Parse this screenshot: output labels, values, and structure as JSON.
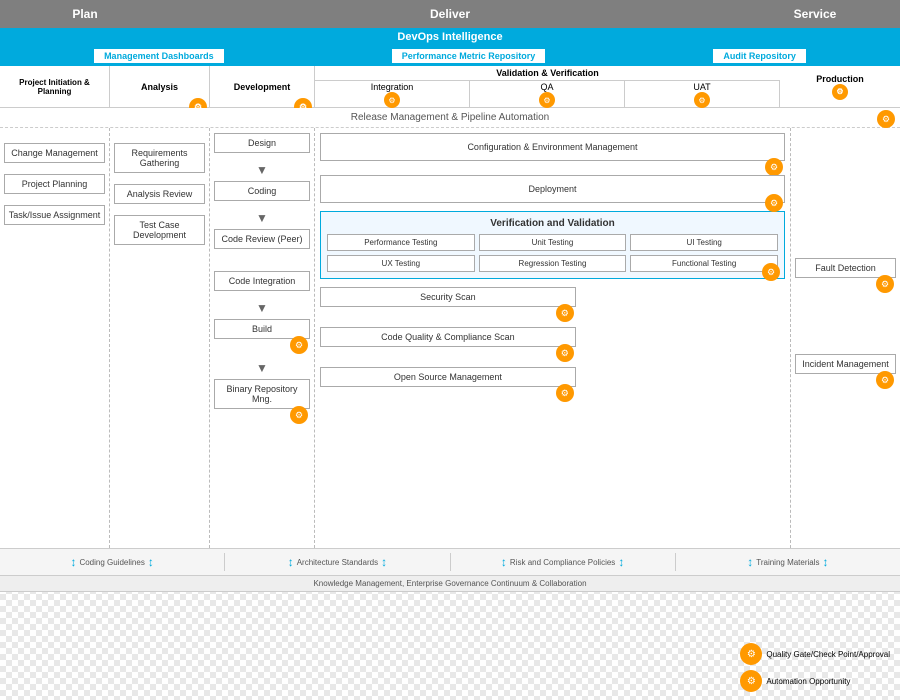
{
  "header": {
    "phases": {
      "plan": "Plan",
      "deliver": "Deliver",
      "service": "Service"
    }
  },
  "devops": {
    "title": "DevOps Intelligence",
    "sub_items": [
      "Management Dashboards",
      "Performance Metric Repository",
      "Audit Repository"
    ]
  },
  "lifecycle": {
    "project": "Project Initiation & Planning",
    "analysis": "Analysis",
    "development": "Development",
    "vv": "Validation & Verification",
    "integration": "Integration",
    "qa": "QA",
    "uat": "UAT",
    "production": "Production"
  },
  "release_bar": "Release Management & Pipeline Automation",
  "process": {
    "project_items": [
      "Change Management",
      "Project Planning",
      "Task/Issue Assignment"
    ],
    "analysis_items": [
      "Requirements Gathering",
      "Analysis Review",
      "Test Case Development"
    ],
    "development_items": [
      "Design",
      "Coding",
      "Code Review (Peer)",
      "Code Integration",
      "Build",
      "Binary Repository Mng."
    ],
    "vv_title": "Verification and Validation",
    "vv_items_row1": [
      "Performance Testing",
      "Unit Testing",
      "UI Testing"
    ],
    "vv_items_row2": [
      "UX Testing",
      "Regression Testing",
      "Functional Testing"
    ],
    "scan_items": [
      "Security Scan",
      "Code Quality & Compliance Scan",
      "Open Source Management"
    ],
    "right_items": [
      "Configuration & Environment Management",
      "Deployment"
    ],
    "service_items": [
      "Fault Detection",
      "Incident Management"
    ]
  },
  "bottom": {
    "standards": [
      "Coding Guidelines",
      "Architecture Standards",
      "Risk and Compliance Policies",
      "Training Materials"
    ],
    "km": "Knowledge Management, Enterprise Governance Continuum & Collaboration"
  },
  "legend": {
    "quality": "Quality Gate/Check Point/Approval",
    "automation": "Automation Opportunity"
  }
}
